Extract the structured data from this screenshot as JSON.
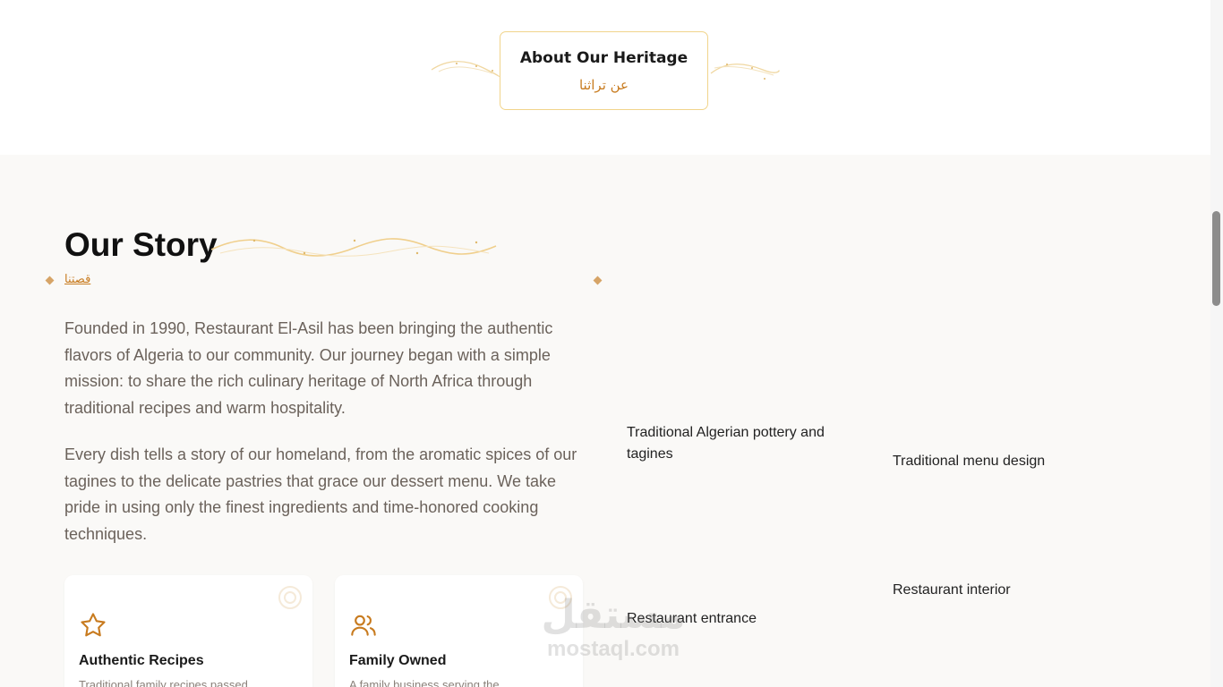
{
  "heritage": {
    "title": "About Our Heritage",
    "arabic": "عن تراثنا"
  },
  "story": {
    "title": "Our Story",
    "arabic": "قصتنا",
    "paragraphs": [
      "Founded in 1990, Restaurant El-Asil has been bringing the authentic flavors of Algeria to our community. Our journey began with a simple mission: to share the rich culinary heritage of North Africa through traditional recipes and warm hospitality.",
      "Every dish tells a story of our homeland, from the aromatic spices of our tagines to the delicate pastries that grace our dessert menu. We take pride in using only the finest ingredients and time-honored cooking techniques."
    ],
    "features": [
      {
        "icon": "star-icon",
        "title": "Authentic Recipes",
        "description": "Traditional family recipes passed"
      },
      {
        "icon": "users-icon",
        "title": "Family Owned",
        "description": "A family business serving the"
      }
    ],
    "images": [
      {
        "alt": "Traditional Algerian pottery and tagines"
      },
      {
        "alt": "Traditional menu design"
      },
      {
        "alt": "Restaurant interior"
      },
      {
        "alt": "Restaurant entrance"
      }
    ]
  },
  "watermark": {
    "arabic": "مستقل",
    "latin": "mostaql.com"
  },
  "colors": {
    "accent": "#c87b1f",
    "card_border": "#f1d48b",
    "section_bg": "#faf9f7",
    "body_text": "#6b625b"
  }
}
